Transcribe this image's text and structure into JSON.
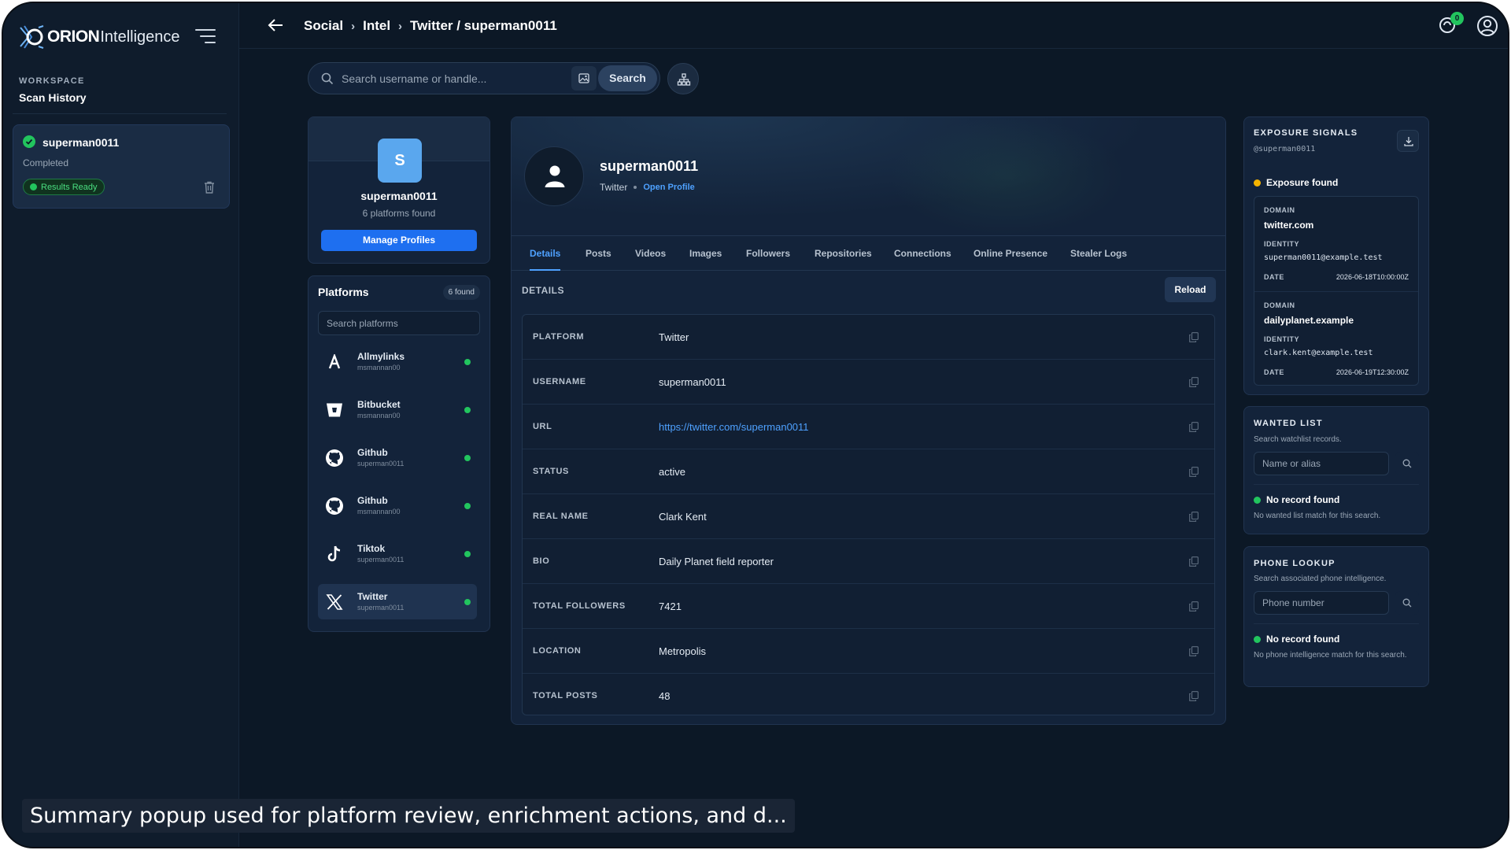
{
  "app": {
    "logo_bold": "ORION",
    "logo_light": "Intelligence"
  },
  "sidebar": {
    "workspace_label": "WORKSPACE",
    "section_title": "Scan History",
    "scan": {
      "name": "superman0011",
      "status": "Completed",
      "badge": "Results Ready"
    }
  },
  "topbar": {
    "breadcrumbs": [
      "Social",
      "Intel",
      "Twitter / superman0011"
    ],
    "notification_count": "0"
  },
  "search": {
    "placeholder": "Search username or handle...",
    "button": "Search"
  },
  "profile": {
    "initial": "S",
    "name": "superman0011",
    "platforms_found": "6 platforms found",
    "manage_button": "Manage Profiles"
  },
  "platforms": {
    "title": "Platforms",
    "count_badge": "6 found",
    "search_placeholder": "Search platforms",
    "items": [
      {
        "name": "Allmylinks",
        "user": "msmannan00",
        "icon": "allmylinks-icon"
      },
      {
        "name": "Bitbucket",
        "user": "msmannan00",
        "icon": "bitbucket-icon"
      },
      {
        "name": "Github",
        "user": "superman0011",
        "icon": "github-icon"
      },
      {
        "name": "Github",
        "user": "msmannan00",
        "icon": "github-icon"
      },
      {
        "name": "Tiktok",
        "user": "superman0011",
        "icon": "tiktok-icon"
      },
      {
        "name": "Twitter",
        "user": "superman0011",
        "icon": "x-icon"
      }
    ]
  },
  "detail": {
    "name": "superman0011",
    "platform": "Twitter",
    "open_profile": "Open Profile",
    "tabs": [
      "Details",
      "Posts",
      "Videos",
      "Images",
      "Followers",
      "Repositories",
      "Connections",
      "Online Presence",
      "Stealer Logs"
    ],
    "active_tab": "Details",
    "section_label": "DETAILS",
    "reload_button": "Reload",
    "rows": [
      {
        "key": "PLATFORM",
        "value": "Twitter"
      },
      {
        "key": "USERNAME",
        "value": "superman0011"
      },
      {
        "key": "URL",
        "value": "https://twitter.com/superman0011"
      },
      {
        "key": "STATUS",
        "value": "active"
      },
      {
        "key": "REAL NAME",
        "value": "Clark Kent"
      },
      {
        "key": "BIO",
        "value": "Daily Planet field reporter"
      },
      {
        "key": "TOTAL FOLLOWERS",
        "value": "7421"
      },
      {
        "key": "LOCATION",
        "value": "Metropolis"
      },
      {
        "key": "TOTAL POSTS",
        "value": "48"
      }
    ]
  },
  "exposure": {
    "title": "EXPOSURE SIGNALS",
    "handle": "@superman0011",
    "status": "Exposure found",
    "domain_label": "DOMAIN",
    "identity_label": "IDENTITY",
    "date_label": "DATE",
    "breaches": [
      {
        "domain": "twitter.com",
        "identity": "superman0011@example.test",
        "date": "2026-06-18T10:00:00Z"
      },
      {
        "domain": "dailyplanet.example",
        "identity": "clark.kent@example.test",
        "date": "2026-06-19T12:30:00Z"
      }
    ]
  },
  "wanted": {
    "title": "WANTED LIST",
    "subtitle": "Search watchlist records.",
    "placeholder": "Name or alias",
    "result": "No record found",
    "result_sub": "No wanted list match for this search."
  },
  "phone": {
    "title": "PHONE LOOKUP",
    "subtitle": "Search associated phone intelligence.",
    "placeholder": "Phone number",
    "result": "No record found",
    "result_sub": "No phone intelligence match for this search."
  },
  "caption": "Summary popup used for platform review, enrichment actions, and d...",
  "colors": {
    "accent": "#1e6ff0",
    "link": "#4ea1ff",
    "success": "#22c55e",
    "warning": "#f5b400",
    "background": "#0c1826"
  }
}
